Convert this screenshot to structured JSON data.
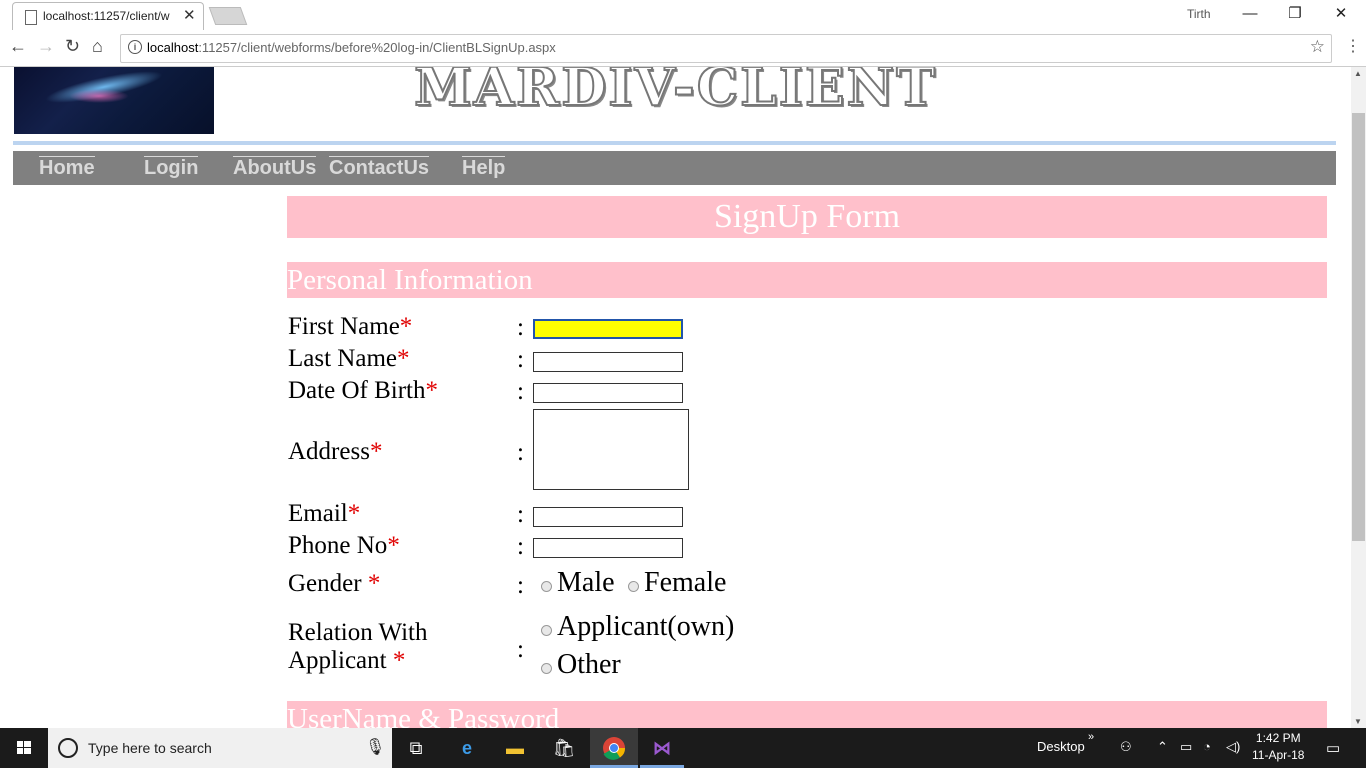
{
  "browser": {
    "tab_title": "localhost:11257/client/w",
    "user": "Tirth",
    "url_host": "localhost",
    "url_path": ":11257/client/webforms/before%20log-in/ClientBLSignUp.aspx"
  },
  "site": {
    "brand": "MARDIV-CLIENT",
    "nav": [
      "Home",
      "Login",
      "AboutUs",
      "ContactUs",
      "Help"
    ]
  },
  "form": {
    "title": "SignUp Form",
    "section_personal": "Personal Information",
    "section_credentials": "UserName & Password",
    "required_mark": "*",
    "colon": ":",
    "fields": {
      "first_name": "First Name",
      "last_name": "Last Name",
      "dob": "Date Of Birth",
      "address": "Address",
      "email": "Email",
      "phone": "Phone No",
      "gender": "Gender ",
      "relation_line1": "Relation With",
      "relation_line2": "Applicant "
    },
    "gender_options": [
      "Male",
      "Female"
    ],
    "relation_options": [
      "Applicant(own)",
      "Other"
    ]
  },
  "taskbar": {
    "search_placeholder": "Type here to search",
    "desktop_label": "Desktop",
    "time": "1:42 PM",
    "date": "11-Apr-18"
  },
  "colors": {
    "pink": "#ffc0cb",
    "navbar": "#808080",
    "required": "#e00000",
    "focused_input": "#ffff00"
  }
}
